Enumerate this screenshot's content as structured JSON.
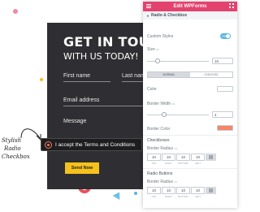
{
  "form": {
    "title": "GET IN TOUCH",
    "subtitle": "WITH US TODAY!",
    "first_name_label": "First name",
    "last_name_label": "Last name",
    "email_label": "Email address",
    "message_label": "Message",
    "terms_text": "I accept the Terms and Conditions",
    "submit_label": "Send Now"
  },
  "annotation": {
    "line1": "Stylish",
    "line2": "Radio",
    "line3": "Checkbox"
  },
  "panel": {
    "header_title": "Edit WPForms",
    "section_title": "Radio & Checkbox",
    "custom_styles_label": "Custom Styles",
    "custom_styles_toggle": "YES",
    "size_label": "Size",
    "size_value": "15",
    "tab_normal": "NORMAL",
    "tab_checked": "CHECKED",
    "color_label": "Color",
    "border_width_label": "Border Width",
    "border_width_value": "4",
    "border_color_label": "Border Color",
    "border_color_value": "#f4866a",
    "checkboxes_label": "Checkboxes",
    "checkbox_radius_label": "Border Radius",
    "checkbox_radius": [
      "10",
      "10",
      "10",
      "10"
    ],
    "radio_buttons_label": "Radio Buttons",
    "radio_radius_label": "Border Radius",
    "radio_radius": [
      "10",
      "10",
      "10",
      "10"
    ],
    "dim_captions": [
      "TOP",
      "RIGHT",
      "BOTTOM",
      "LEFT"
    ]
  },
  "colors": {
    "accent": "#e3426f",
    "form_bg": "#2f2f33",
    "button": "#f5c21b",
    "toggle": "#58b4e4"
  }
}
